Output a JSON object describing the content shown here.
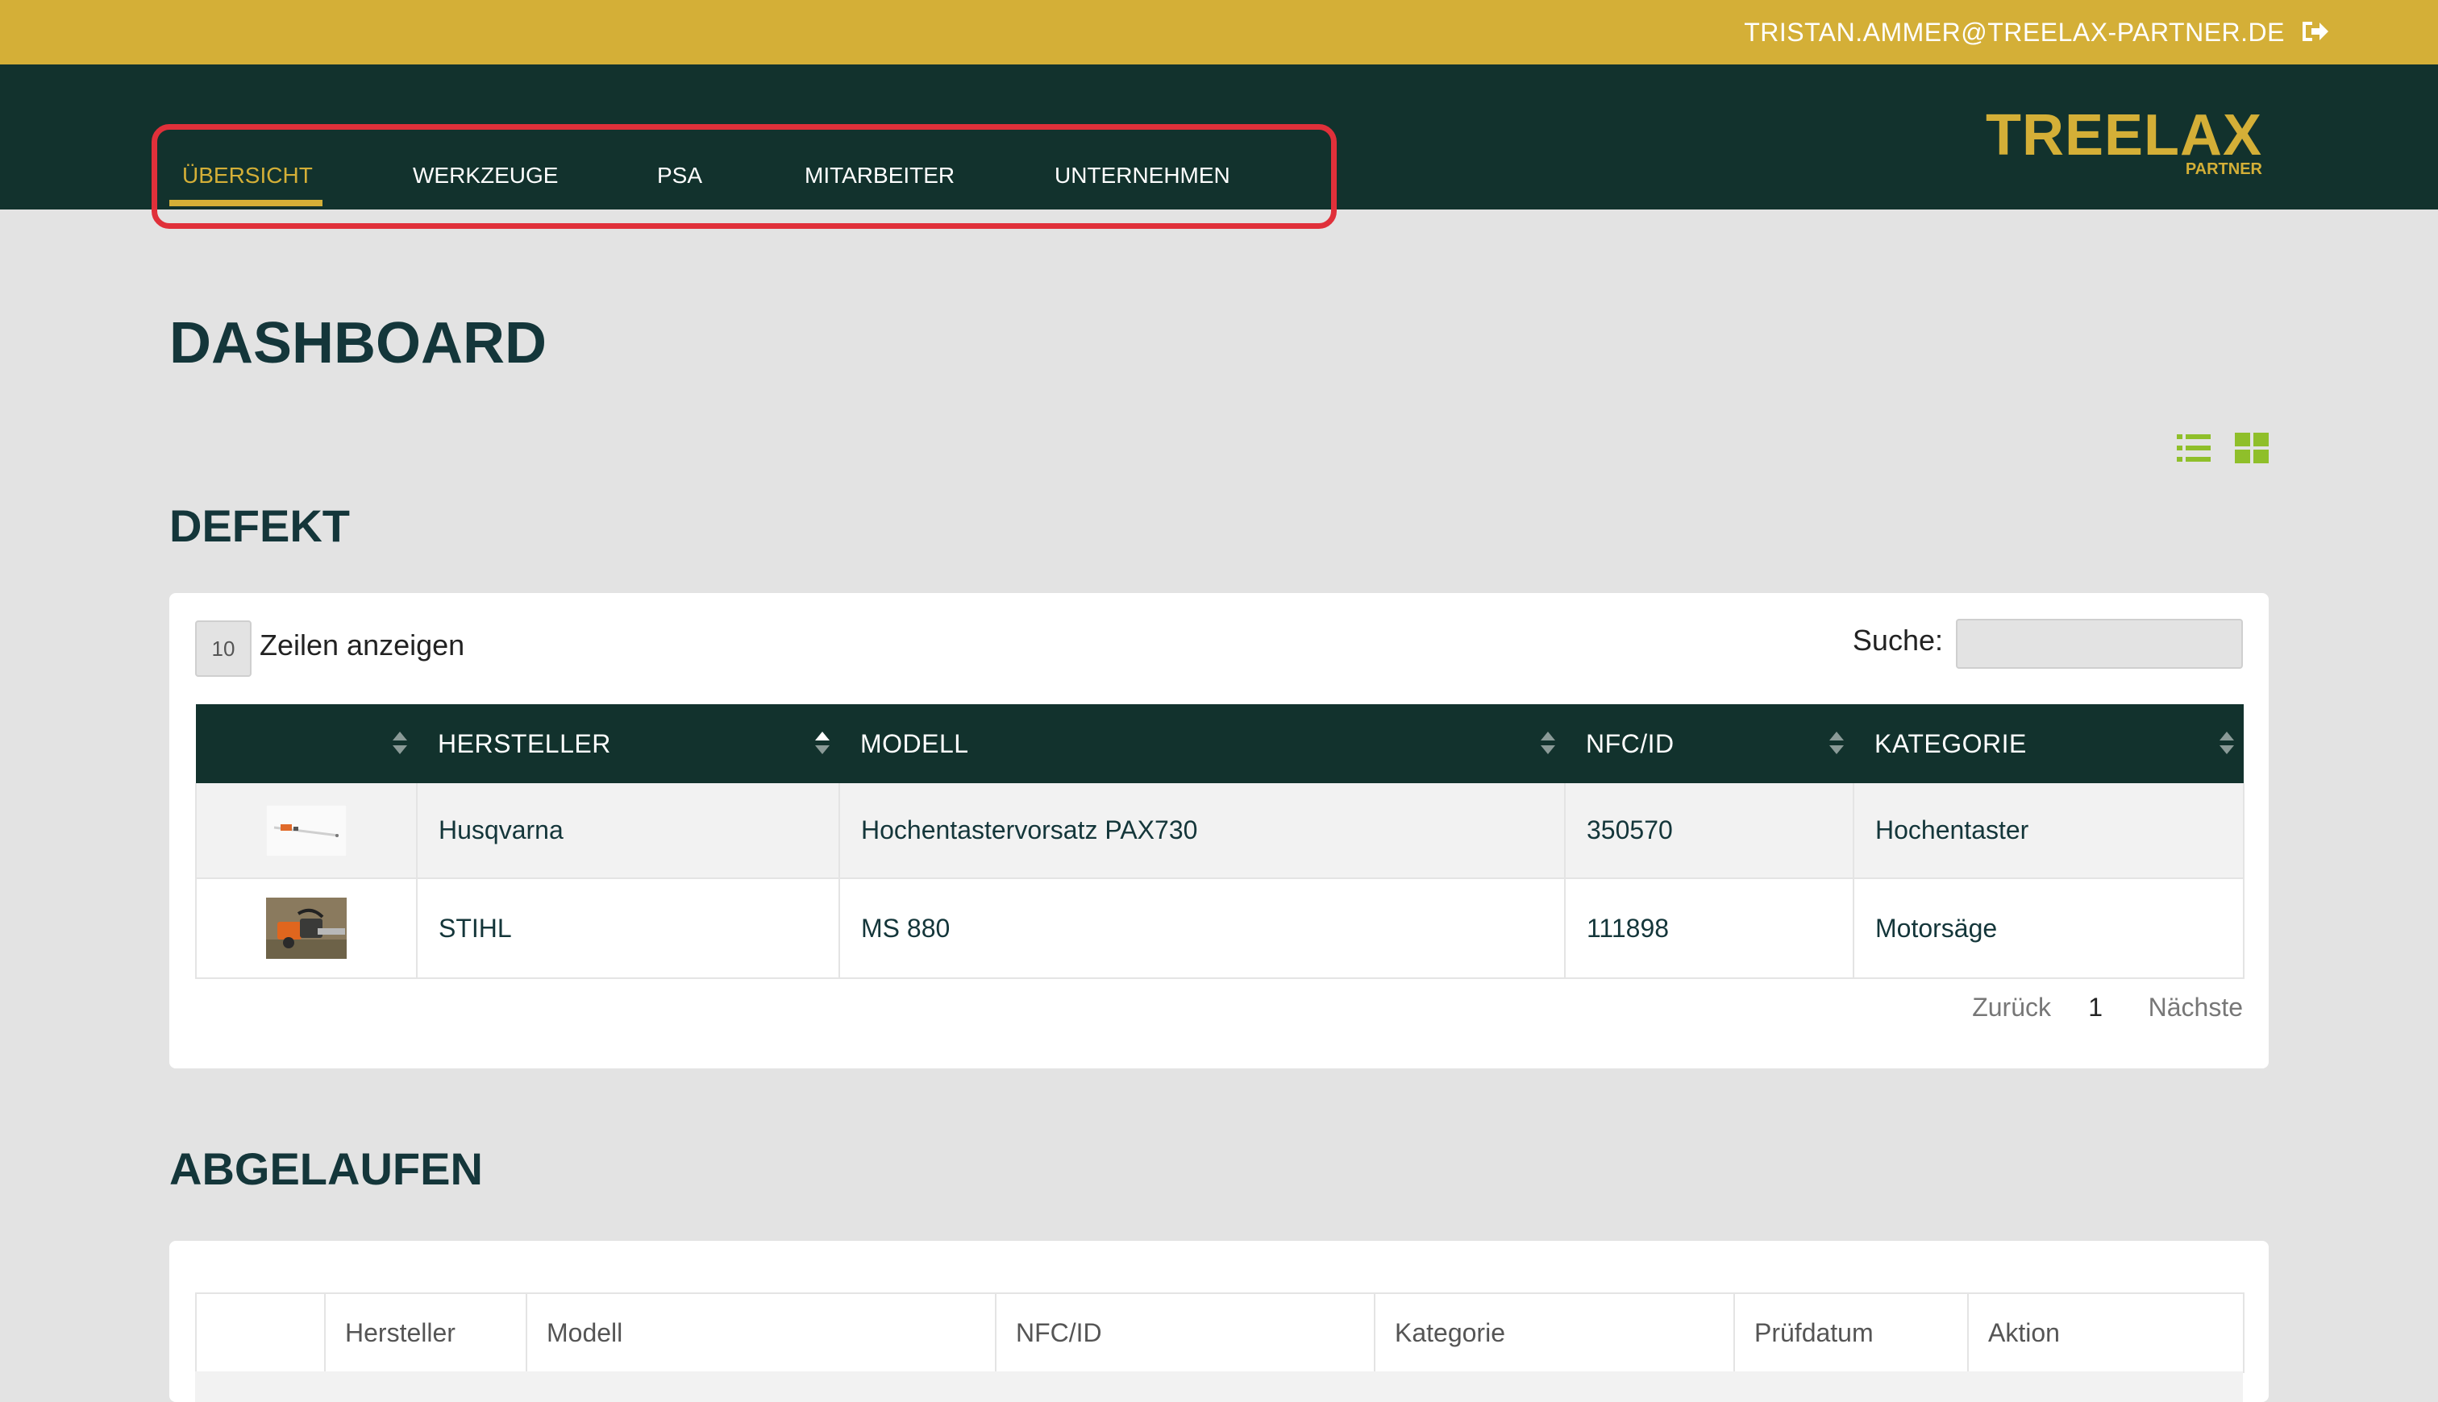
{
  "topbar": {
    "email": "TRISTAN.AMMER@TREELAX-PARTNER.DE",
    "logout_icon": "logout-icon"
  },
  "nav": {
    "items": [
      {
        "label": "ÜBERSICHT",
        "active": true
      },
      {
        "label": "WERKZEUGE",
        "active": false
      },
      {
        "label": "PSA",
        "active": false
      },
      {
        "label": "MITARBEITER",
        "active": false
      },
      {
        "label": "UNTERNEHMEN",
        "active": false
      }
    ]
  },
  "logo": {
    "brand": "TREELAX",
    "sub": "PARTNER"
  },
  "page": {
    "title": "DASHBOARD"
  },
  "view_toggle": {
    "list_icon": "list-view-icon",
    "grid_icon": "grid-view-icon"
  },
  "defekt": {
    "title": "DEFEKT",
    "length_value": "10",
    "length_label": "Zeilen anzeigen",
    "search_label": "Suche:",
    "search_value": "",
    "columns": [
      "",
      "HERSTELLER",
      "MODELL",
      "NFC/ID",
      "KATEGORIE"
    ],
    "rows": [
      {
        "image": "hedge-pole-pruner-image",
        "hersteller": "Husqvarna",
        "modell": "Hochentastervorsatz PAX730",
        "nfc": "350570",
        "kategorie": "Hochentaster"
      },
      {
        "image": "chainsaw-image",
        "hersteller": "STIHL",
        "modell": "MS 880",
        "nfc": "111898",
        "kategorie": "Motorsäge"
      }
    ],
    "pager": {
      "prev": "Zurück",
      "current": "1",
      "next": "Nächste"
    }
  },
  "abgelaufen": {
    "title": "ABGELAUFEN",
    "columns": [
      "",
      "Hersteller",
      "Modell",
      "NFC/ID",
      "Kategorie",
      "Prüfdatum",
      "Aktion"
    ]
  },
  "colors": {
    "topbar": "#d4af37",
    "nav": "#12322d",
    "accent_green": "#8fbf2a",
    "highlight": "#e0303a",
    "text_dark": "#14363a"
  }
}
